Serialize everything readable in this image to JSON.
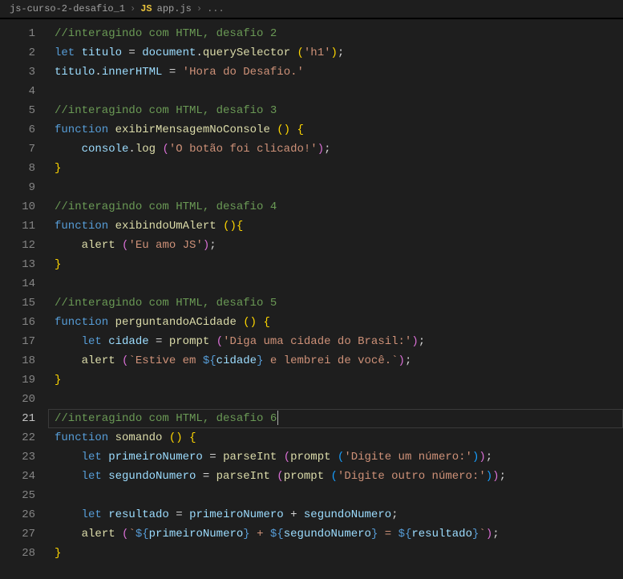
{
  "breadcrumb": {
    "folder": "js-curso-2-desafio_1",
    "js_badge": "JS",
    "file": "app.js",
    "tail": "..."
  },
  "lines": [
    {
      "n": 1,
      "tokens": [
        [
          "comment",
          "//interagindo com HTML, desafio 2"
        ]
      ]
    },
    {
      "n": 2,
      "tokens": [
        [
          "keyword",
          "let "
        ],
        [
          "var",
          "titulo"
        ],
        [
          "op",
          " = "
        ],
        [
          "var",
          "document"
        ],
        [
          "punct",
          "."
        ],
        [
          "func",
          "querySelector"
        ],
        [
          "op",
          " "
        ],
        [
          "brace-y",
          "("
        ],
        [
          "string",
          "'h1'"
        ],
        [
          "brace-y",
          ")"
        ],
        [
          "punct",
          ";"
        ]
      ]
    },
    {
      "n": 3,
      "tokens": [
        [
          "var",
          "titulo"
        ],
        [
          "punct",
          "."
        ],
        [
          "var",
          "innerHTML"
        ],
        [
          "op",
          " = "
        ],
        [
          "string",
          "'Hora do Desafio.'"
        ]
      ]
    },
    {
      "n": 4,
      "tokens": []
    },
    {
      "n": 5,
      "tokens": [
        [
          "comment",
          "//interagindo com HTML, desafio 3"
        ]
      ]
    },
    {
      "n": 6,
      "tokens": [
        [
          "keyword",
          "function "
        ],
        [
          "func",
          "exibirMensagemNoConsole"
        ],
        [
          "op",
          " "
        ],
        [
          "brace-y",
          "("
        ],
        [
          "brace-y",
          ")"
        ],
        [
          "op",
          " "
        ],
        [
          "brace-y",
          "{"
        ]
      ]
    },
    {
      "n": 7,
      "indent": 1,
      "tokens": [
        [
          "var",
          "console"
        ],
        [
          "punct",
          "."
        ],
        [
          "func",
          "log"
        ],
        [
          "op",
          " "
        ],
        [
          "brace-p",
          "("
        ],
        [
          "string",
          "'O botão foi clicado!'"
        ],
        [
          "brace-p",
          ")"
        ],
        [
          "punct",
          ";"
        ]
      ]
    },
    {
      "n": 8,
      "tokens": [
        [
          "brace-y",
          "}"
        ]
      ]
    },
    {
      "n": 9,
      "tokens": []
    },
    {
      "n": 10,
      "tokens": [
        [
          "comment",
          "//interagindo com HTML, desafio 4"
        ]
      ]
    },
    {
      "n": 11,
      "tokens": [
        [
          "keyword",
          "function "
        ],
        [
          "func",
          "exibindoUmAlert"
        ],
        [
          "op",
          " "
        ],
        [
          "brace-y",
          "("
        ],
        [
          "brace-y",
          ")"
        ],
        [
          "brace-y",
          "{"
        ]
      ]
    },
    {
      "n": 12,
      "indent": 1,
      "tokens": [
        [
          "func",
          "alert"
        ],
        [
          "op",
          " "
        ],
        [
          "brace-p",
          "("
        ],
        [
          "string",
          "'Eu amo JS'"
        ],
        [
          "brace-p",
          ")"
        ],
        [
          "punct",
          ";"
        ]
      ]
    },
    {
      "n": 13,
      "tokens": [
        [
          "brace-y",
          "}"
        ]
      ]
    },
    {
      "n": 14,
      "tokens": []
    },
    {
      "n": 15,
      "tokens": [
        [
          "comment",
          "//interagindo com HTML, desafio 5"
        ]
      ]
    },
    {
      "n": 16,
      "tokens": [
        [
          "keyword",
          "function "
        ],
        [
          "func",
          "perguntandoACidade"
        ],
        [
          "op",
          " "
        ],
        [
          "brace-y",
          "("
        ],
        [
          "brace-y",
          ")"
        ],
        [
          "op",
          " "
        ],
        [
          "brace-y",
          "{"
        ]
      ]
    },
    {
      "n": 17,
      "indent": 1,
      "tokens": [
        [
          "keyword",
          "let "
        ],
        [
          "var",
          "cidade"
        ],
        [
          "op",
          " = "
        ],
        [
          "func",
          "prompt"
        ],
        [
          "op",
          " "
        ],
        [
          "brace-p",
          "("
        ],
        [
          "string",
          "'Diga uma cidade do Brasil:'"
        ],
        [
          "brace-p",
          ")"
        ],
        [
          "punct",
          ";"
        ]
      ]
    },
    {
      "n": 18,
      "indent": 1,
      "tokens": [
        [
          "func",
          "alert"
        ],
        [
          "op",
          " "
        ],
        [
          "brace-p",
          "("
        ],
        [
          "string",
          "`Estive em "
        ],
        [
          "templ",
          "${"
        ],
        [
          "var",
          "cidade"
        ],
        [
          "templ",
          "}"
        ],
        [
          "string",
          " e lembrei de você.`"
        ],
        [
          "brace-p",
          ")"
        ],
        [
          "punct",
          ";"
        ]
      ]
    },
    {
      "n": 19,
      "tokens": [
        [
          "brace-y",
          "}"
        ]
      ]
    },
    {
      "n": 20,
      "tokens": []
    },
    {
      "n": 21,
      "current": true,
      "tokens": [
        [
          "comment",
          "//interagindo com HTML, desafio 6"
        ]
      ]
    },
    {
      "n": 22,
      "tokens": [
        [
          "keyword",
          "function "
        ],
        [
          "func",
          "somando"
        ],
        [
          "op",
          " "
        ],
        [
          "brace-y",
          "("
        ],
        [
          "brace-y",
          ")"
        ],
        [
          "op",
          " "
        ],
        [
          "brace-y",
          "{"
        ]
      ]
    },
    {
      "n": 23,
      "indent": 1,
      "tokens": [
        [
          "keyword",
          "let "
        ],
        [
          "var",
          "primeiroNumero"
        ],
        [
          "op",
          " = "
        ],
        [
          "func",
          "parseInt"
        ],
        [
          "op",
          " "
        ],
        [
          "brace-p",
          "("
        ],
        [
          "func",
          "prompt"
        ],
        [
          "op",
          " "
        ],
        [
          "brace-b",
          "("
        ],
        [
          "string",
          "'Digite um número:'"
        ],
        [
          "brace-b",
          ")"
        ],
        [
          "brace-p",
          ")"
        ],
        [
          "punct",
          ";"
        ]
      ]
    },
    {
      "n": 24,
      "indent": 1,
      "tokens": [
        [
          "keyword",
          "let "
        ],
        [
          "var",
          "segundoNumero"
        ],
        [
          "op",
          " = "
        ],
        [
          "func",
          "parseInt"
        ],
        [
          "op",
          " "
        ],
        [
          "brace-p",
          "("
        ],
        [
          "func",
          "prompt"
        ],
        [
          "op",
          " "
        ],
        [
          "brace-b",
          "("
        ],
        [
          "string",
          "'Digite outro número:'"
        ],
        [
          "brace-b",
          ")"
        ],
        [
          "brace-p",
          ")"
        ],
        [
          "punct",
          ";"
        ]
      ]
    },
    {
      "n": 25,
      "indent": 1,
      "tokens": []
    },
    {
      "n": 26,
      "indent": 1,
      "tokens": [
        [
          "keyword",
          "let "
        ],
        [
          "var",
          "resultado"
        ],
        [
          "op",
          " = "
        ],
        [
          "var",
          "primeiroNumero"
        ],
        [
          "op",
          " + "
        ],
        [
          "var",
          "segundoNumero"
        ],
        [
          "punct",
          ";"
        ]
      ]
    },
    {
      "n": 27,
      "indent": 1,
      "tokens": [
        [
          "func",
          "alert"
        ],
        [
          "op",
          " "
        ],
        [
          "brace-p",
          "("
        ],
        [
          "string",
          "`"
        ],
        [
          "templ",
          "${"
        ],
        [
          "var",
          "primeiroNumero"
        ],
        [
          "templ",
          "}"
        ],
        [
          "string",
          " + "
        ],
        [
          "templ",
          "${"
        ],
        [
          "var",
          "segundoNumero"
        ],
        [
          "templ",
          "}"
        ],
        [
          "string",
          " = "
        ],
        [
          "templ",
          "${"
        ],
        [
          "var",
          "resultado"
        ],
        [
          "templ",
          "}"
        ],
        [
          "string",
          "`"
        ],
        [
          "brace-p",
          ")"
        ],
        [
          "punct",
          ";"
        ]
      ]
    },
    {
      "n": 28,
      "tokens": [
        [
          "brace-y",
          "}"
        ]
      ]
    }
  ]
}
